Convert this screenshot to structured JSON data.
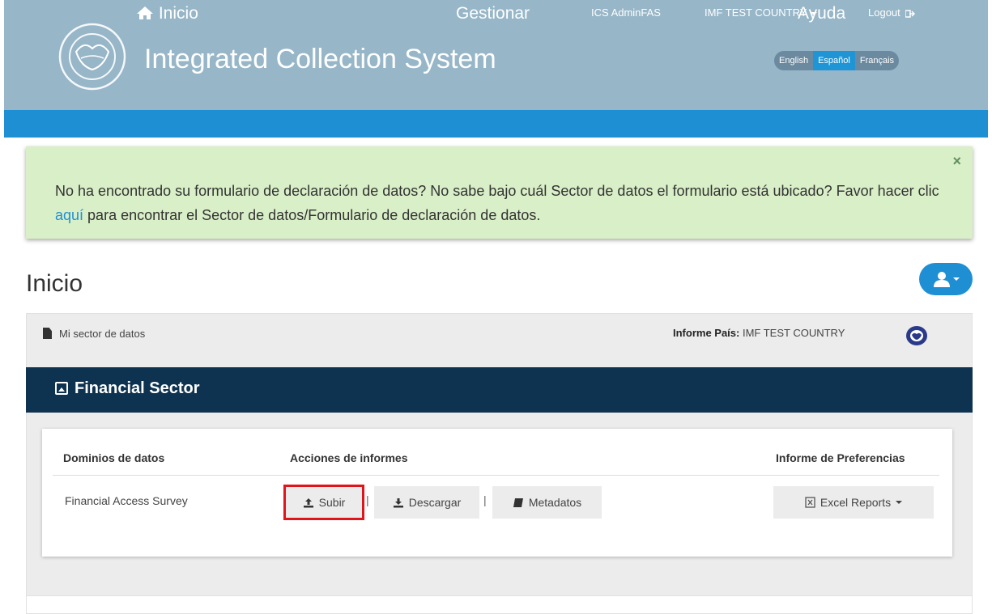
{
  "header": {
    "title": "Integrated Collection System",
    "user": "ICS AdminFAS",
    "country_menu": "IMF TEST COUNTRY",
    "logout": "Logout",
    "languages": [
      "English",
      "Español",
      "Français"
    ],
    "active_language": "Español"
  },
  "nav": {
    "home": "Inicio",
    "manage": "Gestionar",
    "help": "Ayuda"
  },
  "alert": {
    "close": "×",
    "text_before": "No ha encontrado su formulario de declaración de datos? No sabe bajo cuál Sector de datos el formulario está ubicado? Favor hacer clic ",
    "link": "aquí",
    "text_after": " para encontrar el Sector de datos/Formulario de declaración de datos."
  },
  "page": {
    "title": "Inicio"
  },
  "panel": {
    "label": "Mi sector de datos",
    "country_label": "Informe País:",
    "country_value": "IMF TEST COUNTRY"
  },
  "sector": {
    "title": "Financial Sector"
  },
  "table": {
    "headers": [
      "Dominios de datos",
      "Acciones de informes",
      "Informe de Preferencias"
    ],
    "row": {
      "domain": "Financial Access Survey",
      "upload": "Subir",
      "download": "Descargar",
      "metadata": "Metadatos",
      "excel": "Excel Reports"
    }
  },
  "colors": {
    "header_bg": "#97b6c8",
    "nav_bg": "#1f8fd4",
    "alert_bg": "#d9efc7",
    "sector_bg": "#0e3350",
    "highlight": "#e0151b"
  }
}
